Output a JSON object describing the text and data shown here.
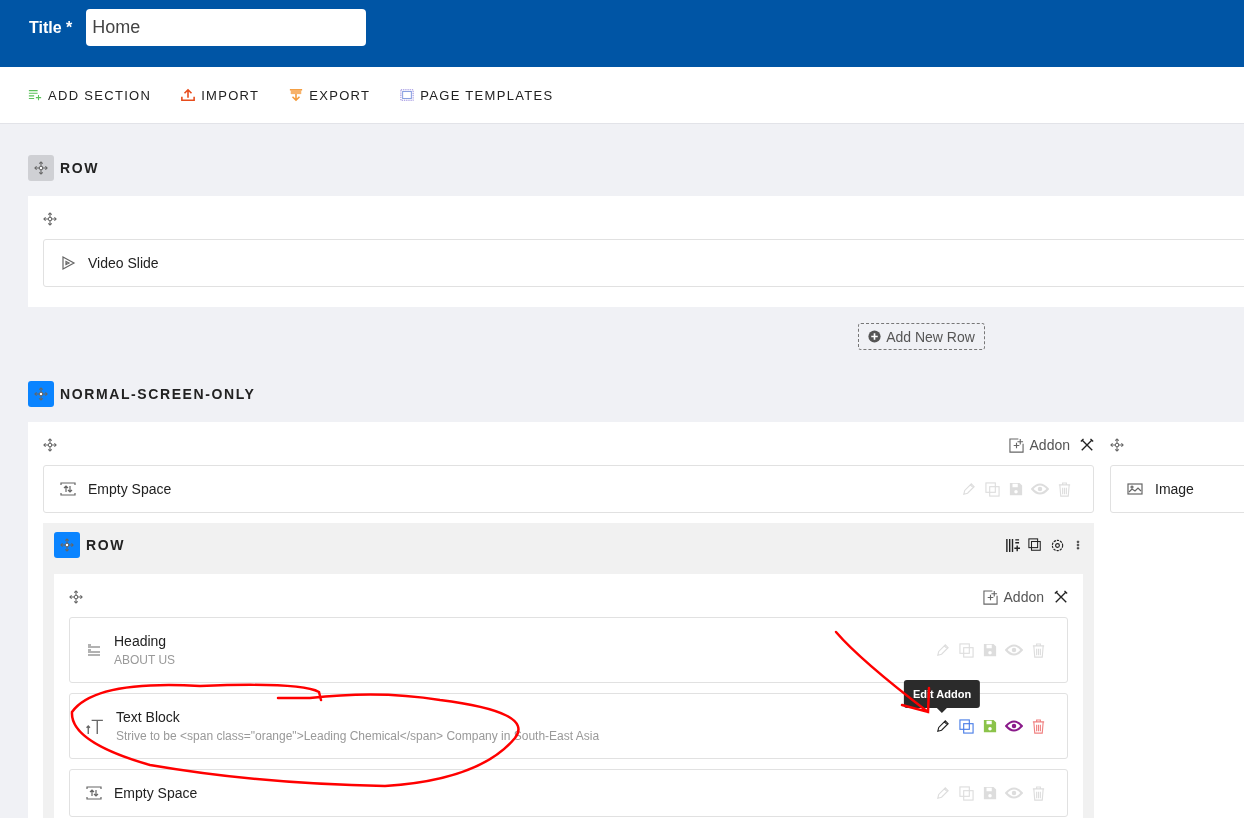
{
  "title_field": {
    "label": "Title *",
    "value": "Home"
  },
  "toolbar": [
    {
      "kind": "add",
      "label": "ADD SECTION"
    },
    {
      "kind": "import",
      "label": "IMPORT"
    },
    {
      "kind": "export",
      "label": "EXPORT"
    },
    {
      "kind": "templates",
      "label": "PAGE TEMPLATES"
    }
  ],
  "sections": [
    {
      "title": "ROW",
      "highlighted": false,
      "add_row_label": "Add New Row",
      "columns": [
        {
          "items": [
            {
              "kind": "video",
              "name": "Video Slide"
            }
          ]
        }
      ]
    },
    {
      "title": "NORMAL-SCREEN-ONLY",
      "highlighted": true,
      "columns": [
        {
          "addon_label": "Addon",
          "items": [
            {
              "kind": "empty",
              "name": "Empty Space",
              "active": false
            },
            {
              "kind": "row",
              "title": "ROW",
              "highlighted": true,
              "columns": [
                {
                  "addon_label": "Addon",
                  "items": [
                    {
                      "kind": "heading",
                      "name": "Heading",
                      "subtitle": "ABOUT US",
                      "active": false
                    },
                    {
                      "kind": "text",
                      "name": "Text Block",
                      "subtitle": "Strive to be <span class=\"orange\">Leading Chemical</span> Company in South-East Asia",
                      "active": true,
                      "tooltip": "Edit Addon"
                    },
                    {
                      "kind": "empty",
                      "name": "Empty Space",
                      "active": false
                    }
                  ]
                }
              ]
            }
          ]
        },
        {
          "items": [
            {
              "kind": "image",
              "name": "Image"
            }
          ]
        }
      ]
    }
  ]
}
